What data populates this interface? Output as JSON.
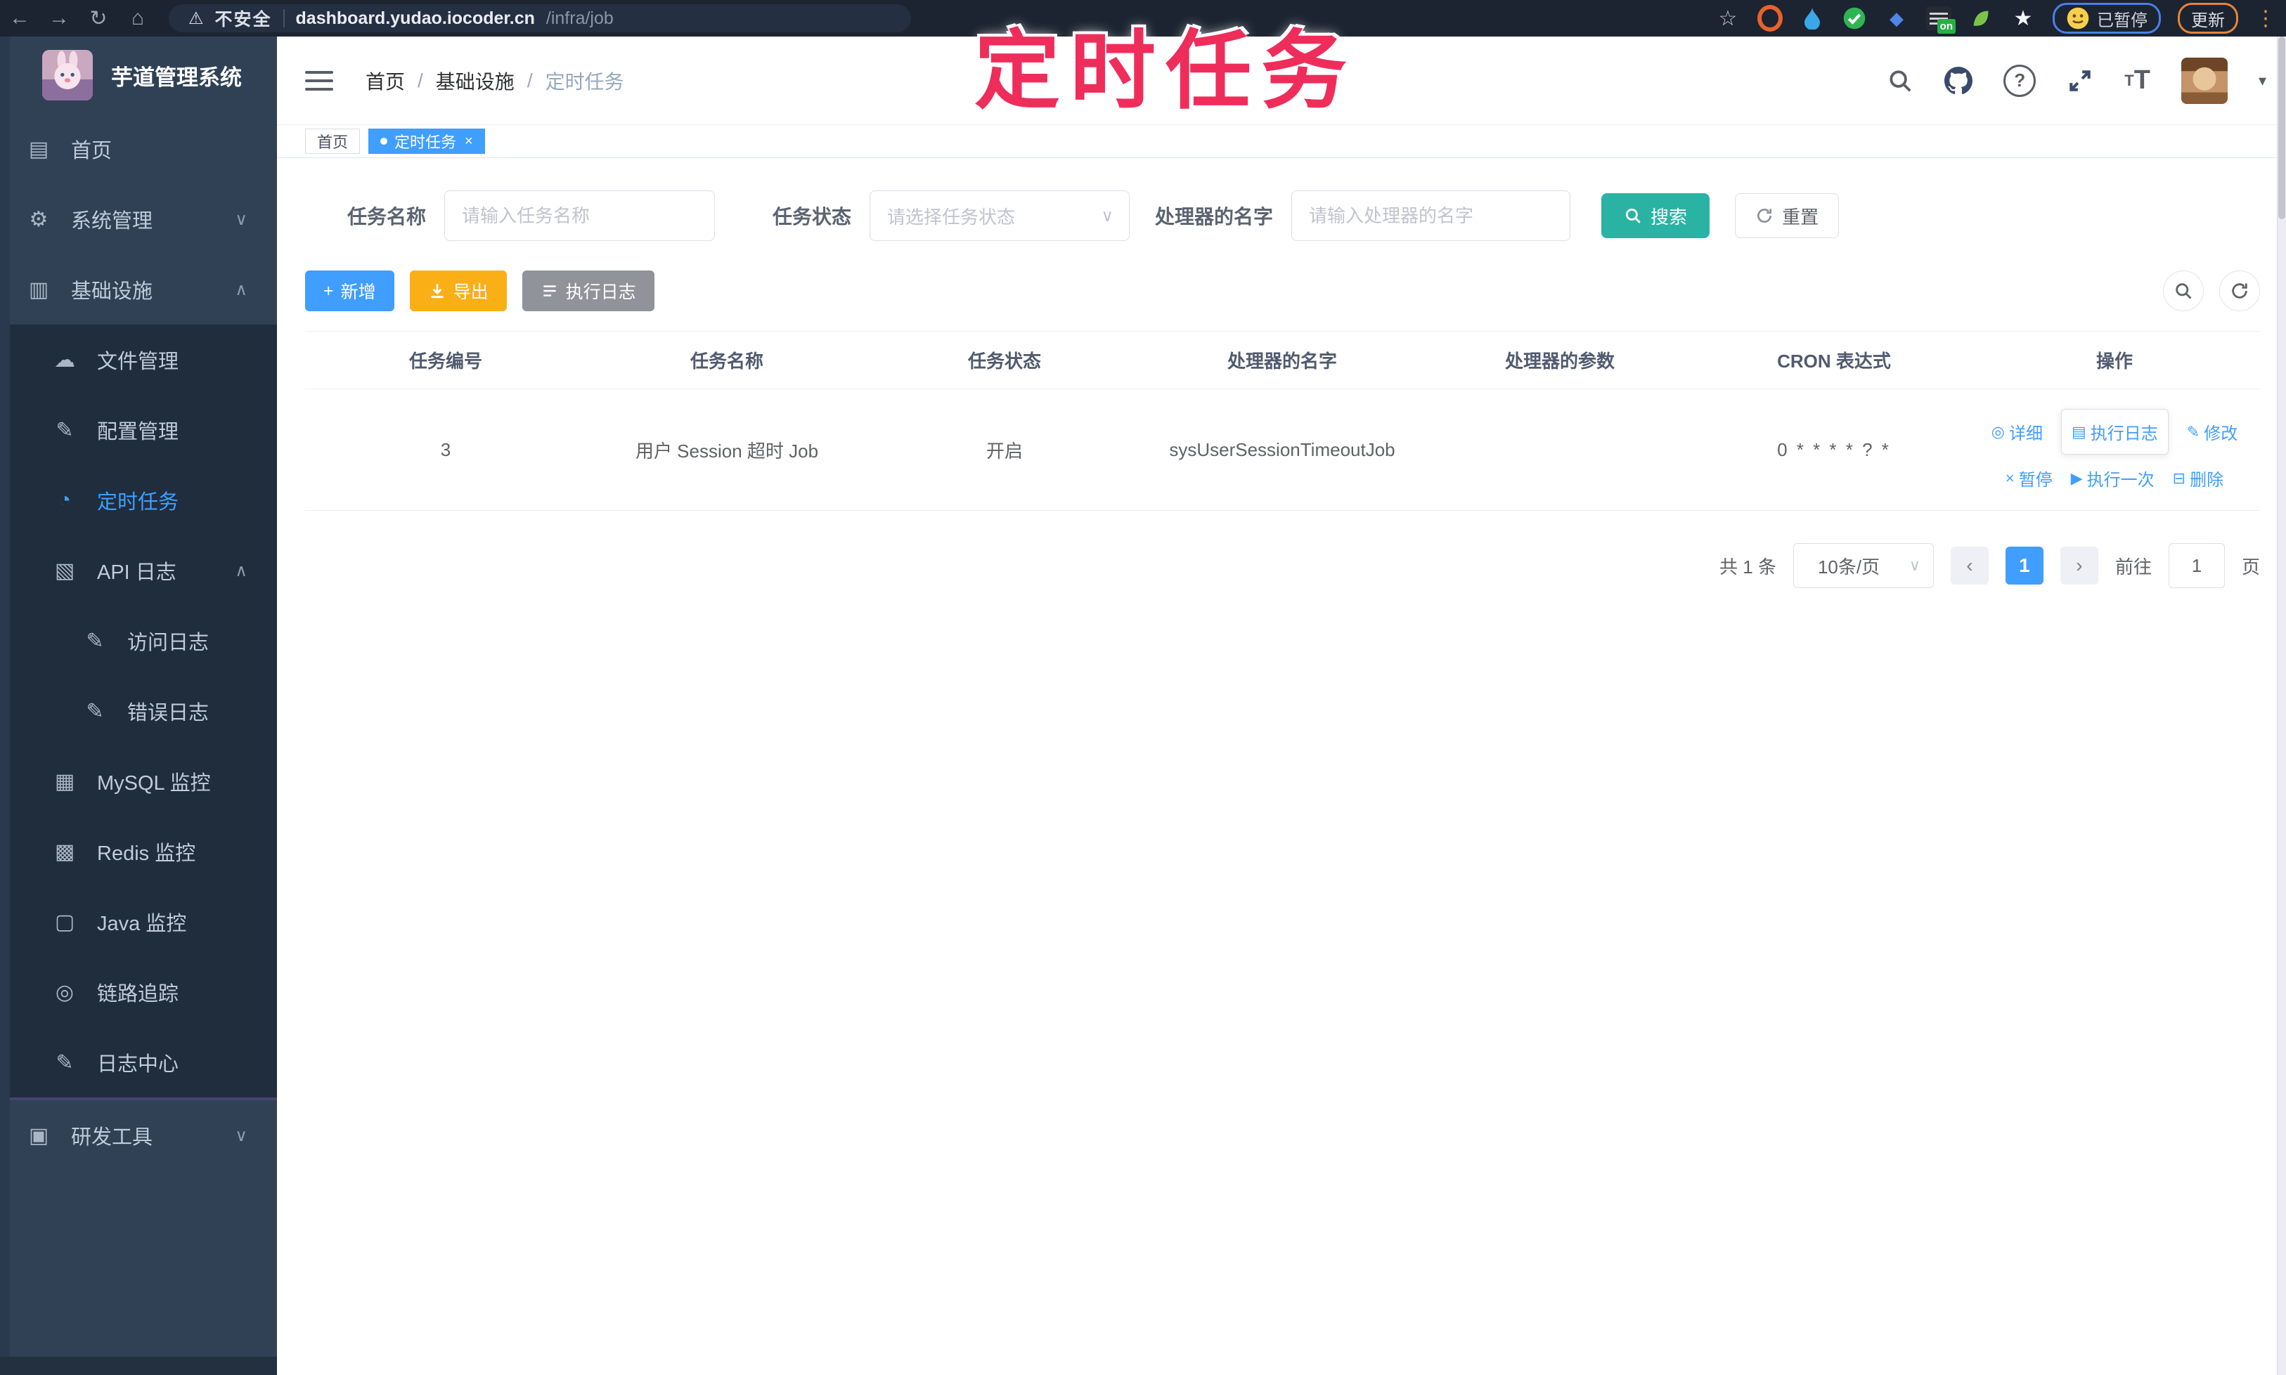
{
  "browser": {
    "security_label": "不安全",
    "url_host": "dashboard.yudao.iocoder.cn",
    "url_path": "/infra/job",
    "paused_badge": "已暂停",
    "update_label": "更新",
    "on_badge": "on"
  },
  "overlay_title": "定时任务",
  "icons": {
    "back": "←",
    "forward": "→",
    "reload": "↻",
    "home": "⌂",
    "warning": "⚠",
    "bookmark_star": "☆",
    "white_star": "★",
    "gem": "◆",
    "kebab": "⋮",
    "hamburger_note": "hamburger",
    "caret_down": "▾",
    "chevron_down": "∨",
    "chevron_up": "∧",
    "select_caret": "∨",
    "dashboard": "▤",
    "gear": "⚙",
    "infra": "▥",
    "cloud": "☁",
    "edit": "✎",
    "clock": "◔",
    "api_log": "▧",
    "access_log": "✎",
    "error_log": "✎",
    "mysql": "▦",
    "redis": "▩",
    "java": "▢",
    "trace": "◎",
    "log_center": "✎",
    "devtools": "▣",
    "detail": "◎",
    "exec_log": "▤",
    "modify": "✎",
    "pause": "×",
    "play": "▶",
    "trash": "⊟",
    "prev": "‹",
    "next": "›",
    "plus": "+",
    "question": "?"
  },
  "sidebar": {
    "app_title": "芋道管理系统",
    "items": [
      {
        "label": "首页"
      },
      {
        "label": "系统管理"
      },
      {
        "label": "基础设施"
      },
      {
        "label": "文件管理"
      },
      {
        "label": "配置管理"
      },
      {
        "label": "定时任务"
      },
      {
        "label": "API 日志"
      },
      {
        "label": "访问日志"
      },
      {
        "label": "错误日志"
      },
      {
        "label": "MySQL 监控"
      },
      {
        "label": "Redis 监控"
      },
      {
        "label": "Java 监控"
      },
      {
        "label": "链路追踪"
      },
      {
        "label": "日志中心"
      },
      {
        "label": "研发工具"
      }
    ]
  },
  "header": {
    "breadcrumb": [
      "首页",
      "基础设施",
      "定时任务"
    ],
    "separator": "/",
    "fontsize_small": "T",
    "fontsize_big": "T"
  },
  "tabs": [
    {
      "label": "首页"
    },
    {
      "label": "定时任务",
      "close": "×"
    }
  ],
  "filters": {
    "name_label": "任务名称",
    "name_placeholder": "请输入任务名称",
    "status_label": "任务状态",
    "status_placeholder": "请选择任务状态",
    "handler_label": "处理器的名字",
    "handler_placeholder": "请输入处理器的名字",
    "search_label": "搜索",
    "reset_label": "重置"
  },
  "toolbar": {
    "add_label": "新增",
    "export_label": "导出",
    "exec_log_label": "执行日志"
  },
  "table": {
    "columns": [
      "任务编号",
      "任务名称",
      "任务状态",
      "处理器的名字",
      "处理器的参数",
      "CRON 表达式",
      "操作"
    ],
    "rows": [
      {
        "id": "3",
        "name": "用户 Session 超时 Job",
        "status": "开启",
        "handler": "sysUserSessionTimeoutJob",
        "param": "",
        "cron": "0 * * * * ? *",
        "actions": [
          "详细",
          "执行日志",
          "修改",
          "暂停",
          "执行一次",
          "删除"
        ]
      }
    ]
  },
  "pagination": {
    "total": "共 1 条",
    "page_size": "10条/页",
    "page": "1",
    "goto_label": "前往",
    "goto_value": "1",
    "unit": "页"
  },
  "colors": {
    "primary": "#409eff",
    "search_teal": "#2ab3a3",
    "export_yellow": "#fbaf17",
    "info_gray": "#909399",
    "sidebar_bg": "#304156",
    "submenu_bg": "#1f2d3d",
    "overlay_pink": "#ee2d5b"
  }
}
